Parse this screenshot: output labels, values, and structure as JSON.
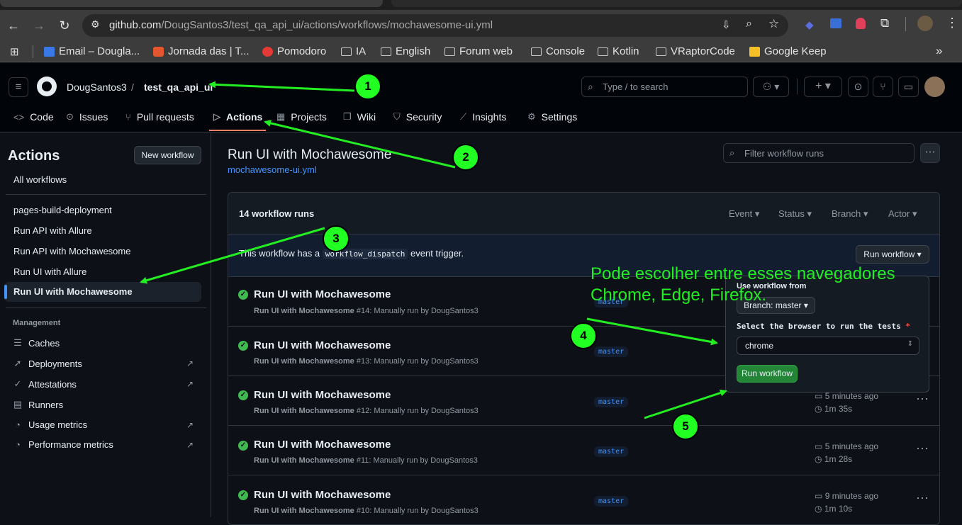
{
  "browser": {
    "url_host": "github.com",
    "url_path": "/DougSantos3/test_qa_api_ui/actions/workflows/mochawesome-ui.yml",
    "bookmarks": [
      "Email – Dougla...",
      "Jornada das | T...",
      "Pomodoro",
      "IA",
      "English",
      "Forum web",
      "Console",
      "Kotlin",
      "VRaptorCode",
      "Google Keep"
    ],
    "more": "»"
  },
  "header": {
    "owner": "DougSantos3",
    "sep": "/",
    "repo": "test_qa_api_ui",
    "search_placeholder": "Type / to search",
    "tabs": [
      "Code",
      "Issues",
      "Pull requests",
      "Actions",
      "Projects",
      "Wiki",
      "Security",
      "Insights",
      "Settings"
    ]
  },
  "sidebar": {
    "title": "Actions",
    "new_workflow": "New workflow",
    "all_workflows": "All workflows",
    "workflows": [
      "pages-build-deployment",
      "Run API with Allure",
      "Run API with Mochawesome",
      "Run UI with Allure",
      "Run UI with Mochawesome"
    ],
    "management_label": "Management",
    "management": [
      "Caches",
      "Deployments",
      "Attestations",
      "Runners",
      "Usage metrics",
      "Performance metrics"
    ]
  },
  "main": {
    "title": "Run UI with Mochawesome",
    "file": "mochawesome-ui.yml",
    "filter_placeholder": "Filter workflow runs",
    "runs_count": "14 workflow runs",
    "filters": [
      "Event",
      "Status",
      "Branch",
      "Actor"
    ],
    "dispatch_prefix": "This workflow has a",
    "dispatch_code": "workflow_dispatch",
    "dispatch_suffix": "event trigger.",
    "run_workflow_btn": "Run workflow",
    "runs": [
      {
        "title": "Run UI with Mochawesome",
        "name": "Run UI with Mochawesome",
        "number": "#14",
        "by": ": Manually run by DougSantos3",
        "branch": "master",
        "when": "",
        "dur": ""
      },
      {
        "title": "Run UI with Mochawesome",
        "name": "Run UI with Mochawesome",
        "number": "#13",
        "by": ": Manually run by DougSantos3",
        "branch": "master",
        "when": "",
        "dur": ""
      },
      {
        "title": "Run UI with Mochawesome",
        "name": "Run UI with Mochawesome",
        "number": "#12",
        "by": ": Manually run by DougSantos3",
        "branch": "master",
        "when": "5 minutes ago",
        "dur": "1m 35s"
      },
      {
        "title": "Run UI with Mochawesome",
        "name": "Run UI with Mochawesome",
        "number": "#11",
        "by": ": Manually run by DougSantos3",
        "branch": "master",
        "when": "5 minutes ago",
        "dur": "1m 28s"
      },
      {
        "title": "Run UI with Mochawesome",
        "name": "Run UI with Mochawesome",
        "number": "#10",
        "by": ": Manually run by DougSantos3",
        "branch": "master",
        "when": "9 minutes ago",
        "dur": "1m 10s"
      }
    ]
  },
  "popup": {
    "use_from": "Use workflow from",
    "branch_select": "Branch: master",
    "browser_label": "Select the browser to run the tests",
    "required": "*",
    "browser_value": "chrome",
    "submit": "Run workflow"
  },
  "annotation": {
    "note_line1": "Pode escolher entre esses navegadores",
    "note_line2": "Chrome, Edge, Firefox.",
    "markers": [
      "1",
      "2",
      "3",
      "4",
      "5"
    ],
    "color": "#22ee22"
  }
}
